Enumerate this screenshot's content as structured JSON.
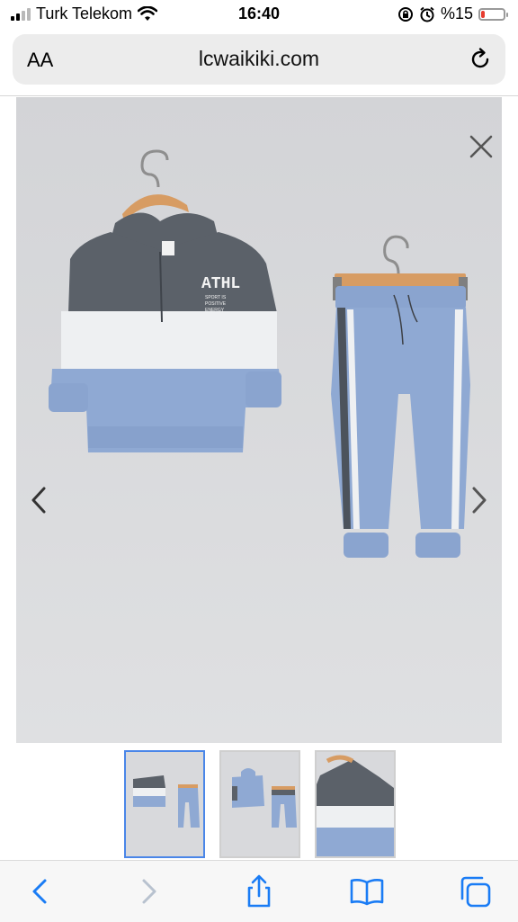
{
  "status_bar": {
    "carrier": "Turk Telekom",
    "time": "16:40",
    "battery_text": "%15",
    "battery_level": 0.15,
    "signal_bars": 2,
    "icons": [
      "wifi-icon",
      "rotation-lock-icon",
      "alarm-icon",
      "battery-icon"
    ]
  },
  "address_bar": {
    "text_size_label": "AA",
    "url": "lcwaikiki.com",
    "reload_icon": "reload-icon"
  },
  "viewer": {
    "image_description_role": "product-photo",
    "garment_print": {
      "title": "ATHL",
      "lines": [
        "SPORT IS",
        "POSITIVE",
        "ENERGY"
      ]
    },
    "close_icon": "close-icon",
    "prev_icon": "chevron-left-icon",
    "next_icon": "chevron-right-icon",
    "colors": {
      "background": "#d8d9dc",
      "charcoal": "#5b6169",
      "white_band": "#eef0f2",
      "light_blue": "#8fa9d3"
    }
  },
  "thumbnails": {
    "items": [
      {
        "label": "thumbnail-1",
        "active": true
      },
      {
        "label": "thumbnail-2",
        "active": false
      },
      {
        "label": "thumbnail-3",
        "active": false
      }
    ],
    "active_color": "#4a86e8"
  },
  "toolbar": {
    "icons": [
      "back-icon",
      "forward-icon",
      "share-icon",
      "bookmarks-icon",
      "tabs-icon"
    ],
    "accent": "#1a7cf5"
  }
}
